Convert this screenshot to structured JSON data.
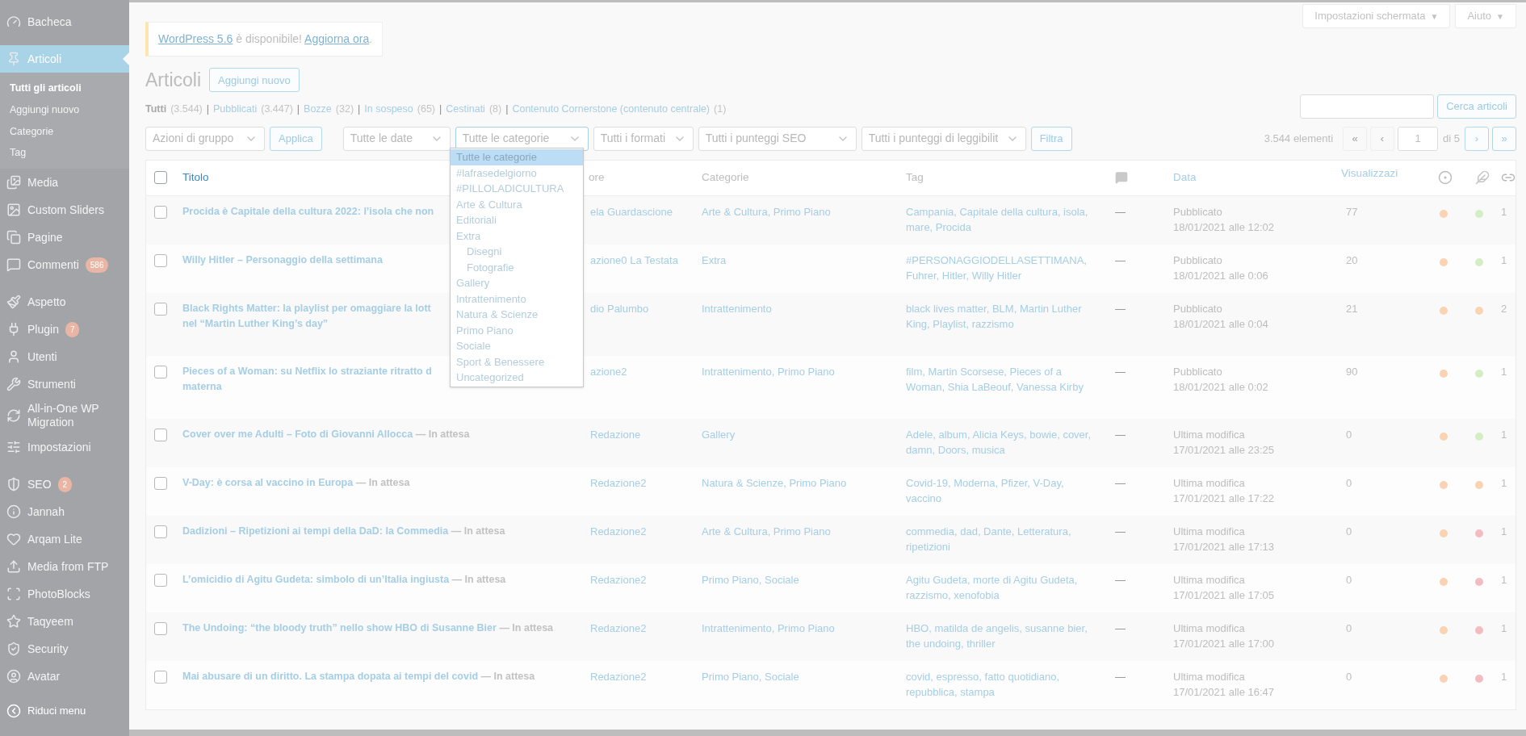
{
  "sidebar": {
    "groups": [
      [
        {
          "label": "Bacheca",
          "selected": false
        }
      ],
      [
        {
          "label": "Articoli",
          "selected": true,
          "children": [
            {
              "label": "Tutti gli articoli",
              "selected": true
            },
            {
              "label": "Aggiungi nuovo",
              "selected": false
            },
            {
              "label": "Categorie",
              "selected": false
            },
            {
              "label": "Tag",
              "selected": false
            }
          ]
        },
        {
          "label": "Media",
          "selected": false
        },
        {
          "label": "Custom Sliders",
          "selected": false
        },
        {
          "label": "Pagine",
          "selected": false
        },
        {
          "label": "Commenti",
          "selected": false,
          "badge": "586"
        }
      ],
      [
        {
          "label": "Aspetto",
          "selected": false
        },
        {
          "label": "Plugin",
          "selected": false,
          "badge": "7"
        },
        {
          "label": "Utenti",
          "selected": false
        },
        {
          "label": "Strumenti",
          "selected": false
        },
        {
          "label": "All-in-One WP Migration",
          "selected": false
        },
        {
          "label": "Impostazioni",
          "selected": false
        }
      ],
      [
        {
          "label": "SEO",
          "selected": false,
          "badge": "2"
        },
        {
          "label": "Jannah",
          "selected": false
        },
        {
          "label": "Arqam Lite",
          "selected": false
        },
        {
          "label": "Media from FTP",
          "selected": false
        },
        {
          "label": "PhotoBlocks",
          "selected": false
        },
        {
          "label": "Taqyeem",
          "selected": false
        },
        {
          "label": "Security",
          "selected": false
        },
        {
          "label": "Avatar",
          "selected": false
        }
      ]
    ],
    "collapse": "Riduci menu"
  },
  "screen_meta": [
    {
      "label": "Impostazioni schermata",
      "caret": "▼"
    },
    {
      "label": "Aiuto",
      "caret": "▼"
    }
  ],
  "notice": {
    "parts": [
      {
        "text": "WordPress 5.6",
        "link": true
      },
      {
        "text": " è disponibile! ",
        "link": false
      },
      {
        "text": "Aggiorna ora",
        "link": true
      },
      {
        "text": ".",
        "link": false
      }
    ]
  },
  "heading": {
    "title": "Articoli",
    "add_new": "Aggiungi nuovo"
  },
  "views": {
    "separator": "|",
    "items": [
      {
        "label": "Tutti",
        "count": "(3.544)",
        "selected": true
      },
      {
        "label": "Pubblicati",
        "count": "(3.447)",
        "selected": false
      },
      {
        "label": "Bozze",
        "count": "(32)",
        "selected": false
      },
      {
        "label": "In sospeso",
        "count": "(65)",
        "selected": false
      },
      {
        "label": "Cestinati",
        "count": "(8)",
        "selected": false
      },
      {
        "label": "Contenuto Cornerstone (contenuto centrale)",
        "count": "(1)",
        "selected": false
      }
    ]
  },
  "search": {
    "button": "Cerca articoli"
  },
  "filters": {
    "bulk_action": "Azioni di gruppo",
    "apply": "Applica",
    "date": "Tutte le date",
    "category": "Tutte le categorie",
    "format": "Tutti i formati",
    "seo": "Tutti i punteggi SEO",
    "readability": "Tutti i punteggi di leggibilit",
    "filter": "Filtra"
  },
  "pagination": {
    "count": "3.544 elementi",
    "first": "«",
    "prev": "‹",
    "page": "1",
    "of": "di 5",
    "next": "›",
    "last": "»"
  },
  "category_dropdown": {
    "expanded": true,
    "options": [
      {
        "label": "Tutte le categorie",
        "selected": true
      },
      {
        "label": "#lafrasedelgiorno",
        "selected": false
      },
      {
        "label": "#PILLOLADICULTURA",
        "selected": false
      },
      {
        "label": "Arte & Cultura",
        "selected": false
      },
      {
        "label": "Editoriali",
        "selected": false
      },
      {
        "label": "Extra",
        "selected": false,
        "children": [
          {
            "label": "Disegni",
            "selected": false
          },
          {
            "label": "Fotografie",
            "selected": false
          }
        ]
      },
      {
        "label": "Gallery",
        "selected": false
      },
      {
        "label": "Intrattenimento",
        "selected": false
      },
      {
        "label": "Natura & Scienze",
        "selected": false
      },
      {
        "label": "Primo Piano",
        "selected": false
      },
      {
        "label": "Sociale",
        "selected": false
      },
      {
        "label": "Sport & Benessere",
        "selected": false
      },
      {
        "label": "Uncategorized",
        "selected": false
      }
    ]
  },
  "table": {
    "select_all_checked": false,
    "columns": {
      "title": "Titolo",
      "author": "ore",
      "categories": "Categorie",
      "tags": "Tag",
      "date": "Data",
      "views": "Visualizzazi"
    },
    "rows": [
      {
        "checked": false,
        "title_lines": [
          "Procida è Capitale della cultura 2022: l’isola che non"
        ],
        "author": "ela Guardascione",
        "categories": "Arte & Cultura, Primo Piano",
        "tags": "Campania, Capitale della cultura, isola, mare, Procida",
        "comments": "—",
        "date_status": "Pubblicato",
        "date": "18/01/2021 alle 12:02",
        "views": "77",
        "scores": [
          {
            "color": "#f9d3b2"
          },
          {
            "color": "#d5edc5"
          }
        ],
        "links": "1"
      },
      {
        "checked": false,
        "title_lines": [
          "Willy Hitler – Personaggio della settimana"
        ],
        "author": "azione0 La Testata",
        "categories": "Extra",
        "tags": "#PERSONAGGIODELLASETTIMANA, Fuhrer, Hitler, Willy Hitler",
        "comments": "—",
        "date_status": "Pubblicato",
        "date": "18/01/2021 alle 0:06",
        "views": "20",
        "scores": [
          {
            "color": "#f9d3b2"
          },
          {
            "color": "#d5edc5"
          }
        ],
        "links": "1"
      },
      {
        "checked": false,
        "title_lines": [
          "Black Rights Matter: la playlist per omaggiare la lott",
          "nel “Martin Luther King’s day”"
        ],
        "author": "dio Palumbo",
        "categories": "Intrattenimento",
        "tags": "black lives matter, BLM, Martin Luther King, Playlist, razzismo",
        "comments": "—",
        "date_status": "Pubblicato",
        "date": "18/01/2021 alle 0:04",
        "views": "21",
        "scores": [
          {
            "color": "#f9d3b2"
          },
          {
            "color": "#f9d3b2"
          }
        ],
        "links": "2"
      },
      {
        "checked": false,
        "title_lines": [
          "Pieces of a Woman: su Netflix lo straziante ritratto d",
          "materna"
        ],
        "author": "azione2",
        "categories": "Intrattenimento, Primo Piano",
        "tags": "film, Martin Scorsese, Pieces of a Woman, Shia LaBeouf, Vanessa Kirby",
        "comments": "—",
        "date_status": "Pubblicato",
        "date": "18/01/2021 alle 0:02",
        "views": "90",
        "scores": [
          {
            "color": "#f9d3b2"
          },
          {
            "color": "#d5edc5"
          }
        ],
        "links": "1"
      },
      {
        "checked": false,
        "title_lines": [
          "Cover over me Adulti – Foto di Giovanni Allocca"
        ],
        "state": "— In attesa",
        "author": "Redazione",
        "categories": "Gallery",
        "tags": "Adele, album, Alicia Keys, bowie, cover, damn, Doors, musica",
        "comments": "—",
        "date_status": "Ultima modifica",
        "date": "17/01/2021 alle 23:25",
        "views": "0",
        "scores": [
          {
            "color": "#f9d3b2"
          },
          {
            "color": "#d5edc5"
          }
        ],
        "links": "1"
      },
      {
        "checked": false,
        "title_lines": [
          "V-Day: è corsa al vaccino in Europa"
        ],
        "state": "— In attesa",
        "author": "Redazione2",
        "categories": "Natura & Scienze, Primo Piano",
        "tags": "Covid-19, Moderna, Pfizer, V-Day, vaccino",
        "comments": "—",
        "date_status": "Ultima modifica",
        "date": "17/01/2021 alle 17:22",
        "views": "0",
        "scores": [
          {
            "color": "#f9d3b2"
          },
          {
            "color": "#f9d3b2"
          }
        ],
        "links": "1"
      },
      {
        "checked": false,
        "title_lines": [
          "Dadizioni – Ripetizioni ai tempi della DaD: la Commedia"
        ],
        "state": "— In attesa",
        "author": "Redazione2",
        "categories": "Arte & Cultura, Primo Piano",
        "tags": "commedia, dad, Dante, Letteratura, ripetizioni",
        "comments": "—",
        "date_status": "Ultima modifica",
        "date": "17/01/2021 alle 17:13",
        "views": "0",
        "scores": [
          {
            "color": "#f9d3b2"
          },
          {
            "color": "#f3bcc1"
          }
        ],
        "links": "1"
      },
      {
        "checked": false,
        "title_lines": [
          "L’omicidio di Agitu Gudeta: simbolo di un’Italia ingiusta"
        ],
        "state": "— In attesa",
        "author": "Redazione2",
        "categories": "Primo Piano, Sociale",
        "tags": "Agitu Gudeta, morte di Agitu Gudeta, razzismo, xenofobia",
        "comments": "—",
        "date_status": "Ultima modifica",
        "date": "17/01/2021 alle 17:05",
        "views": "0",
        "scores": [
          {
            "color": "#f9d3b2"
          },
          {
            "color": "#f3bcc1"
          }
        ],
        "links": "1"
      },
      {
        "checked": false,
        "title_lines": [
          "The Undoing: “the bloody truth” nello show HBO di Susanne Bier"
        ],
        "state": "— In attesa",
        "author": "Redazione2",
        "categories": "Intrattenimento, Primo Piano",
        "tags": "HBO, matilda de angelis, susanne bier, the undoing, thriller",
        "comments": "—",
        "date_status": "Ultima modifica",
        "date": "17/01/2021 alle 17:00",
        "views": "0",
        "scores": [
          {
            "color": "#f9d3b2"
          },
          {
            "color": "#f3bcc1"
          }
        ],
        "links": "1"
      },
      {
        "checked": false,
        "title_lines": [
          "Mai abusare di un diritto. La stampa dopata ai tempi del covid"
        ],
        "state": "— In attesa",
        "author": "Redazione2",
        "categories": "Primo Piano, Sociale",
        "tags": "covid, espresso, fatto quotidiano, repubblica, stampa",
        "comments": "—",
        "date_status": "Ultima modifica",
        "date": "17/01/2021 alle 16:47",
        "views": "0",
        "scores": [
          {
            "color": "#f9d3b2"
          },
          {
            "color": "#f3bcc1"
          }
        ],
        "links": "1"
      }
    ]
  }
}
